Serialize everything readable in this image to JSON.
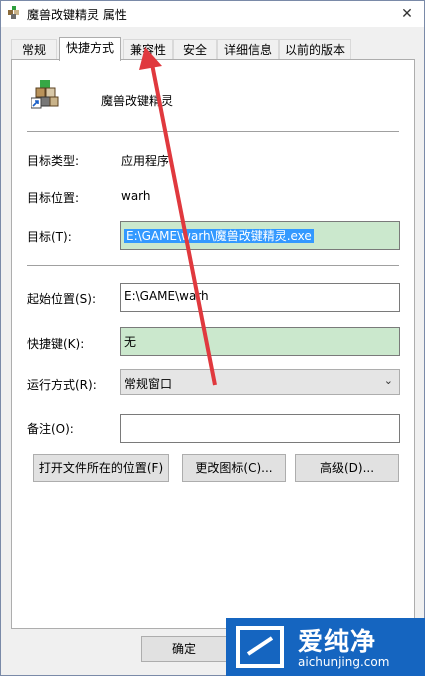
{
  "window": {
    "title": "魔兽改键精灵 属性",
    "close": "✕"
  },
  "tabs": [
    {
      "label": "常规"
    },
    {
      "label": "快捷方式"
    },
    {
      "label": "兼容性"
    },
    {
      "label": "安全"
    },
    {
      "label": "详细信息"
    },
    {
      "label": "以前的版本"
    }
  ],
  "shortcut": {
    "app_name": "魔兽改键精灵",
    "target_type_label": "目标类型:",
    "target_type_value": "应用程序",
    "target_location_label": "目标位置:",
    "target_location_value": "warh",
    "target_label": "目标(T):",
    "target_value": "E:\\GAME\\warh\\魔兽改键精灵.exe",
    "start_in_label": "起始位置(S):",
    "start_in_value": "E:\\GAME\\warh",
    "hotkey_label": "快捷键(K):",
    "hotkey_value": "无",
    "run_label": "运行方式(R):",
    "run_value": "常规窗口",
    "comment_label": "备注(O):",
    "comment_value": ""
  },
  "buttons": {
    "open_location": "打开文件所在的位置(F)",
    "change_icon": "更改图标(C)...",
    "advanced": "高级(D)...",
    "ok": "确定"
  },
  "watermark": {
    "name": "爱纯净",
    "url": "aichunjing.com"
  },
  "colors": {
    "highlight": "#3399ff",
    "green_field": "#cbe8cd",
    "arrow": "#e0393e",
    "logo_bg": "#1565c0"
  }
}
